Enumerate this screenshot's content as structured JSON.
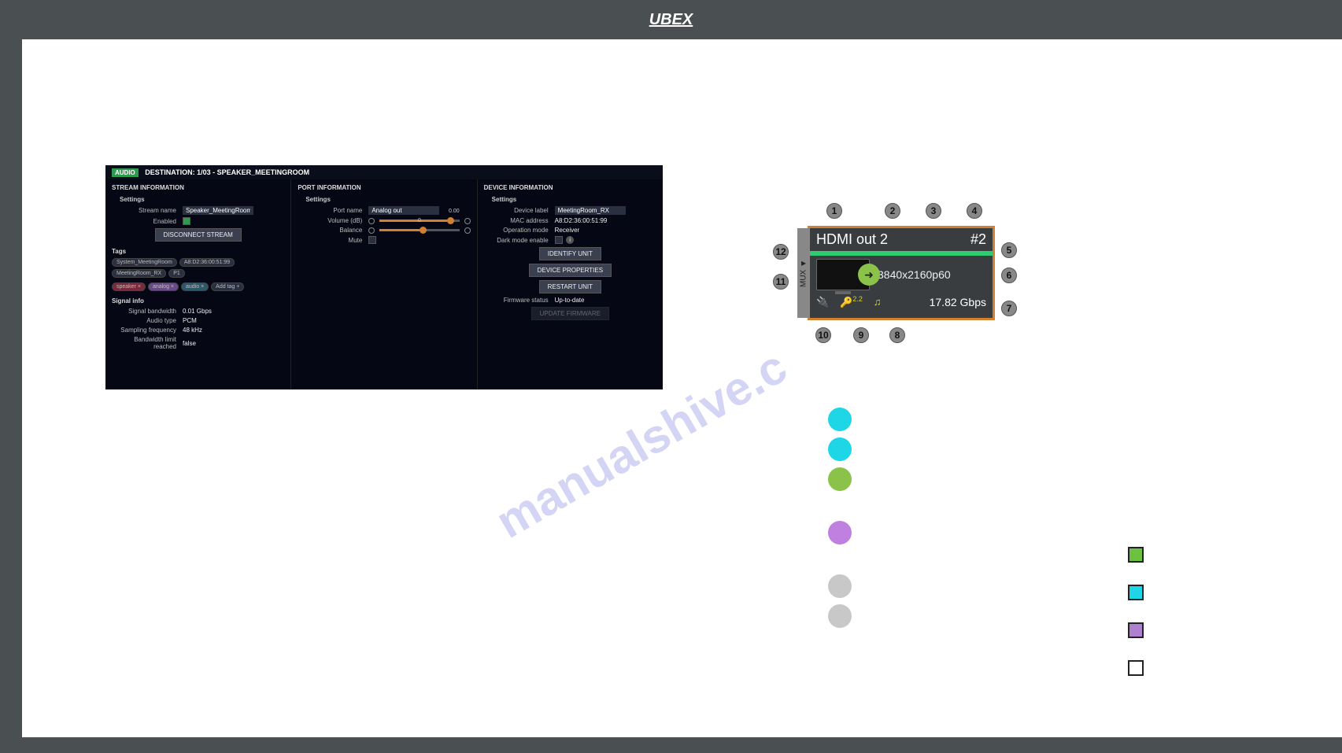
{
  "logo": "UBEX",
  "watermark": "manualshive.c",
  "panel": {
    "badge": "AUDIO",
    "title": "DESTINATION: 1/03 - SPEAKER_MEETINGROOM",
    "stream": {
      "head": "STREAM INFORMATION",
      "settings": "Settings",
      "stream_name_lbl": "Stream name",
      "stream_name": "Speaker_MeetingRoom",
      "enabled_lbl": "Enabled",
      "disconnect": "DISCONNECT STREAM",
      "tags_lbl": "Tags",
      "tags": [
        "System_MeetingRoom",
        "A8:D2:36:00:51:99",
        "MeetingRoom_RX",
        "P1"
      ],
      "tagbtns": [
        "speaker ×",
        "analog ×",
        "audio ×",
        "Add tag +"
      ],
      "sig_lbl": "Signal info",
      "bw_lbl": "Signal bandwidth",
      "bw": "0.01 Gbps",
      "atype_lbl": "Audio type",
      "atype": "PCM",
      "freq_lbl": "Sampling frequency",
      "freq": "48 kHz",
      "blim_lbl": "Bandwidth limit reached",
      "blim": "false"
    },
    "port": {
      "head": "PORT INFORMATION",
      "settings": "Settings",
      "pname_lbl": "Port name",
      "pname": "Analog out",
      "vol_lbl": "Volume (dB)",
      "vol_val": "0.00",
      "bal_lbl": "Balance",
      "bal_val": "0",
      "mute_lbl": "Mute"
    },
    "device": {
      "head": "DEVICE INFORMATION",
      "settings": "Settings",
      "dlabel_lbl": "Device label",
      "dlabel": "MeetingRoom_RX",
      "mac_lbl": "MAC address",
      "mac": "A8:D2:36:00:51:99",
      "op_lbl": "Operation mode",
      "op": "Receiver",
      "dark_lbl": "Dark mode enable",
      "identify": "IDENTIFY UNIT",
      "props": "DEVICE PROPERTIES",
      "restart": "RESTART UNIT",
      "fw_lbl": "Firmware status",
      "fw": "Up-to-date",
      "update": "UPDATE FIRMWARE"
    }
  },
  "tile": {
    "mux": "MUX ◄",
    "name": "HDMI out 2",
    "num": "#2",
    "res": "3840x2160p60",
    "hdcp": "2.2",
    "bw": "17.82 Gbps"
  },
  "callouts": [
    "1",
    "2",
    "3",
    "4",
    "5",
    "6",
    "7",
    "8",
    "9",
    "10",
    "11",
    "12"
  ]
}
